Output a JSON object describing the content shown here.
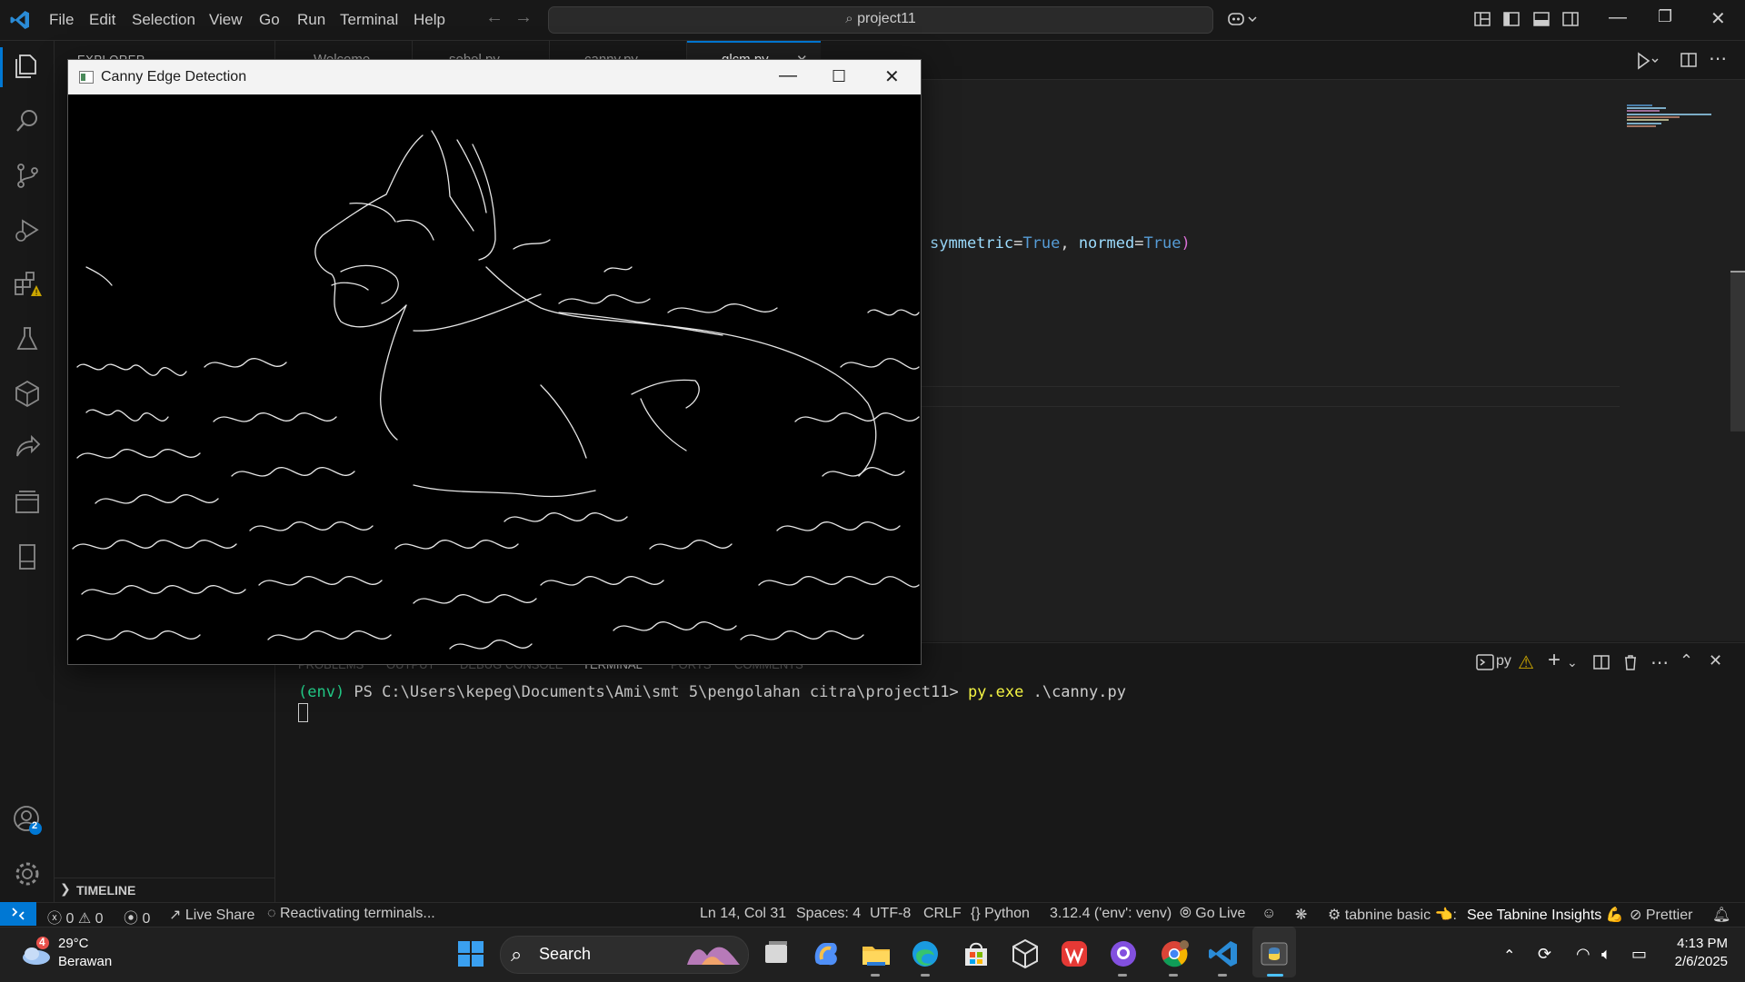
{
  "menu": [
    "File",
    "Edit",
    "Selection",
    "View",
    "Go",
    "Run",
    "Terminal",
    "Help"
  ],
  "command_center": {
    "label": "project11",
    "icon": "search-icon"
  },
  "sidebar": {
    "title": "EXPLORER",
    "timeline_label": "TIMELINE"
  },
  "tabs": [
    {
      "label": "Welcome",
      "icon": "vscode-icon"
    },
    {
      "label": "sobel.py",
      "icon": "python-icon"
    },
    {
      "label": "canny.py",
      "icon": "python-icon"
    },
    {
      "label": "glcm.py",
      "icon": "python-icon",
      "active": true
    }
  ],
  "editor": {
    "code_tokens": [
      {
        "t": "symmetric",
        "c": "param"
      },
      {
        "t": "=",
        "c": "op"
      },
      {
        "t": "True",
        "c": "const"
      },
      {
        "t": ", ",
        "c": "op"
      },
      {
        "t": "normed",
        "c": "param"
      },
      {
        "t": "=",
        "c": "op"
      },
      {
        "t": "True",
        "c": "const"
      },
      {
        "t": ")",
        "c": "paren"
      }
    ]
  },
  "activity_bar": {
    "icons": [
      "explorer-icon",
      "search-icon",
      "source-control-icon",
      "run-debug-icon",
      "extensions-icon",
      "testing-icon",
      "remote-explorer-icon",
      "live-share-icon",
      "layers-icon",
      "notebook-icon"
    ],
    "extensions_badge": "⚠",
    "accounts_badge": "2"
  },
  "panel": {
    "tabs": [
      "PROBLEMS",
      "OUTPUT",
      "DEBUG CONSOLE",
      "TERMINAL",
      "PORTS",
      "COMMENTS"
    ],
    "terminal_kind": "py",
    "terminal_env": "(env)",
    "terminal_prompt": " PS C:\\Users\\kepeg\\Documents\\Ami\\smt 5\\pengolahan citra\\project11> ",
    "terminal_command": "py.exe",
    "terminal_args": " .\\canny.py"
  },
  "statusbar": {
    "errors": "0",
    "warnings": "0",
    "ports": "0",
    "live_share": "Live Share",
    "activity": "Reactivating terminals...",
    "cursor_pos": "Ln 14, Col 31",
    "indent": "Spaces: 4",
    "encoding": "UTF-8",
    "eol": "CRLF",
    "language": "Python",
    "interpreter": "3.12.4 ('env': venv)",
    "go_live": "Go Live",
    "tabnine": "tabnine basic 👈:",
    "tabnine_insights": "See Tabnine Insights 💪",
    "prettier": "Prettier"
  },
  "cv_window": {
    "title": "Canny Edge Detection"
  },
  "taskbar": {
    "weather_badge": "4",
    "temperature": "29°C",
    "condition": "Berawan",
    "search_label": "Search",
    "apps": [
      "windows-start-icon",
      "search-icon",
      "task-view-icon",
      "copilot-icon",
      "file-explorer-icon",
      "edge-icon",
      "store-icon",
      "unity-icon",
      "wps-office-icon",
      "github-icon",
      "chrome-icon",
      "vscode-icon",
      "python-window-icon"
    ],
    "time": "4:13 PM",
    "date": "2/6/2025"
  },
  "colors": {
    "accent": "#0078d4",
    "terminal_env": "#23d18b",
    "terminal_cmd": "#f5f543"
  }
}
